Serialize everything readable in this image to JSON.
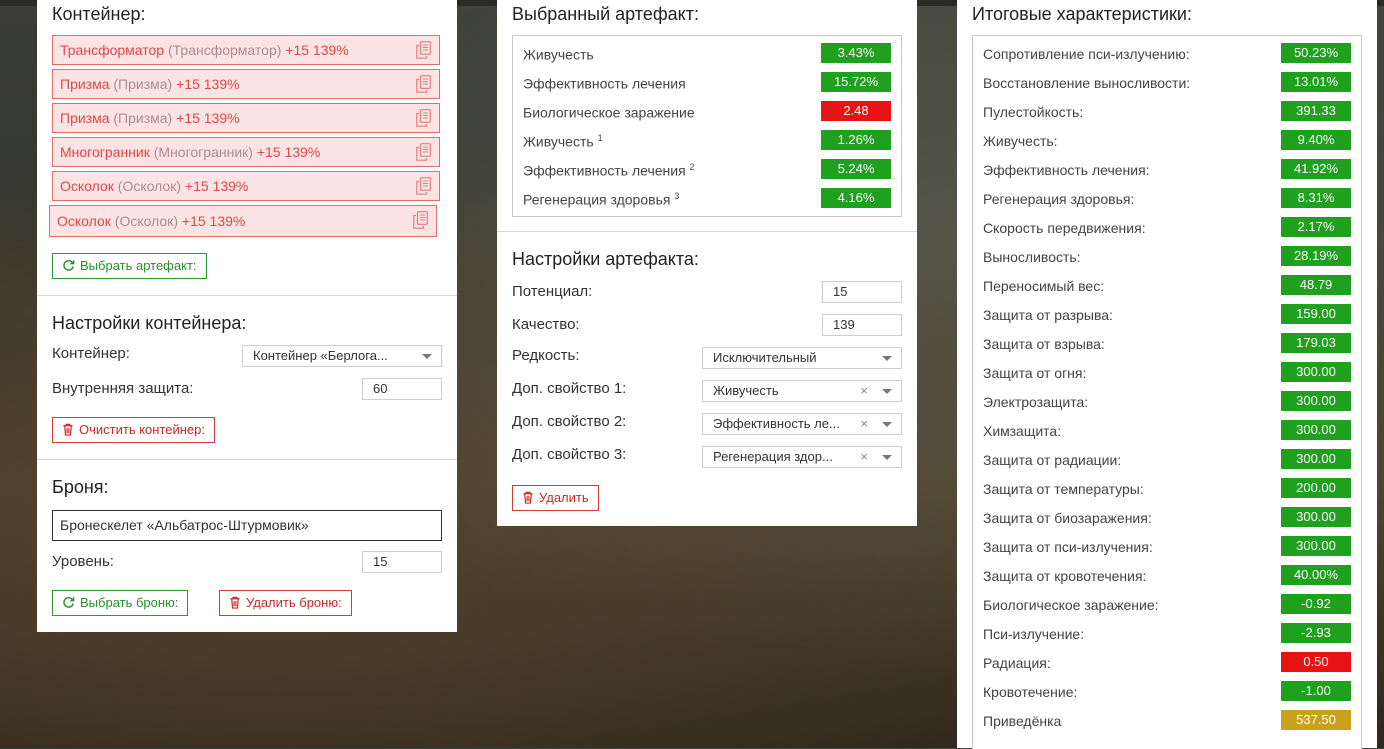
{
  "colors": {
    "green": "#1fa01f",
    "red": "#e51313",
    "gold": "#c9a21d"
  },
  "left": {
    "container_title": "Контейнер:",
    "artifacts": [
      {
        "name": "Трансформатор",
        "type": "(Трансформатор)",
        "bonus": "+15 139%"
      },
      {
        "name": "Призма",
        "type": "(Призма)",
        "bonus": "+15 139%"
      },
      {
        "name": "Призма",
        "type": "(Призма)",
        "bonus": "+15 139%"
      },
      {
        "name": "Многогранник",
        "type": "(Многогранник)",
        "bonus": "+15 139%"
      },
      {
        "name": "Осколок",
        "type": "(Осколок)",
        "bonus": "+15 139%"
      },
      {
        "name": "Осколок",
        "type": "(Осколок)",
        "bonus": "+15 139%"
      }
    ],
    "copy_icon": "copy-icon",
    "select_artifact_button": "Выбрать артефакт:",
    "container_settings_title": "Настройки контейнера:",
    "container_label": "Контейнер:",
    "container_value": "Контейнер «Берлога...",
    "inner_protection_label": "Внутренняя защита:",
    "inner_protection_value": "60",
    "clear_container_button": "Очистить контейнер:",
    "armor_title": "Броня:",
    "armor_value": "Бронескелет «Альбатрос-Штурмовик»",
    "level_label": "Уровень:",
    "level_value": "15",
    "select_armor_button": "Выбрать броню:",
    "delete_armor_button": "Удалить броню:"
  },
  "middle": {
    "selected_title": "Выбранный артефакт:",
    "stats": [
      {
        "label": "Живучесть",
        "sup": "",
        "value": "3.43%",
        "color": "green"
      },
      {
        "label": "Эффективность лечения",
        "sup": "",
        "value": "15.72%",
        "color": "green"
      },
      {
        "label": "Биологическое заражение",
        "sup": "",
        "value": "2.48",
        "color": "red"
      },
      {
        "label": "Живучесть",
        "sup": "1",
        "value": "1.26%",
        "color": "green"
      },
      {
        "label": "Эффективность лечения",
        "sup": "2",
        "value": "5.24%",
        "color": "green"
      },
      {
        "label": "Регенерация здоровья",
        "sup": "3",
        "value": "4.16%",
        "color": "green"
      }
    ],
    "settings_title": "Настройки артефакта:",
    "potential_label": "Потенциал:",
    "potential_value": "15",
    "quality_label": "Качество:",
    "quality_value": "139",
    "rarity_label": "Редкость:",
    "rarity_value": "Исключительный",
    "extra1_label": "Доп. свойство 1:",
    "extra1_value": "Живучесть",
    "extra2_label": "Доп. свойство 2:",
    "extra2_value": "Эффективность ле...",
    "extra3_label": "Доп. свойство 3:",
    "extra3_value": "Регенерация здор...",
    "clear_x": "×",
    "delete_button": "Удалить"
  },
  "right": {
    "title": "Итоговые характеристики:",
    "stats": [
      {
        "label": "Сопротивление пси-излучению:",
        "value": "50.23%",
        "color": "green"
      },
      {
        "label": "Восстановление выносливости:",
        "value": "13.01%",
        "color": "green"
      },
      {
        "label": "Пулестойкость:",
        "value": "391.33",
        "color": "green"
      },
      {
        "label": "Живучесть:",
        "value": "9.40%",
        "color": "green"
      },
      {
        "label": "Эффективность лечения:",
        "value": "41.92%",
        "color": "green"
      },
      {
        "label": "Регенерация здоровья:",
        "value": "8.31%",
        "color": "green"
      },
      {
        "label": "Скорость передвижения:",
        "value": "2.17%",
        "color": "green"
      },
      {
        "label": "Выносливость:",
        "value": "28.19%",
        "color": "green"
      },
      {
        "label": "Переносимый вес:",
        "value": "48.79",
        "color": "green"
      },
      {
        "label": "Защита от разрыва:",
        "value": "159.00",
        "color": "green"
      },
      {
        "label": "Защита от взрыва:",
        "value": "179.03",
        "color": "green"
      },
      {
        "label": "Защита от огня:",
        "value": "300.00",
        "color": "green"
      },
      {
        "label": "Электрозащита:",
        "value": "300.00",
        "color": "green"
      },
      {
        "label": "Химзащита:",
        "value": "300.00",
        "color": "green"
      },
      {
        "label": "Защита от радиации:",
        "value": "300.00",
        "color": "green"
      },
      {
        "label": "Защита от температуры:",
        "value": "200.00",
        "color": "green"
      },
      {
        "label": "Защита от биозаражения:",
        "value": "300.00",
        "color": "green"
      },
      {
        "label": "Защита от пси-излучения:",
        "value": "300.00",
        "color": "green"
      },
      {
        "label": "Защита от кровотечения:",
        "value": "40.00%",
        "color": "green"
      },
      {
        "label": "Биологическое заражение:",
        "value": "-0.92",
        "color": "green"
      },
      {
        "label": "Пси-излучение:",
        "value": "-2.93",
        "color": "green"
      },
      {
        "label": "Радиация:",
        "value": "0.50",
        "color": "red"
      },
      {
        "label": "Кровотечение:",
        "value": "-1.00",
        "color": "green"
      },
      {
        "label": "Приведёнка",
        "value": "537.50",
        "color": "gold"
      }
    ]
  }
}
